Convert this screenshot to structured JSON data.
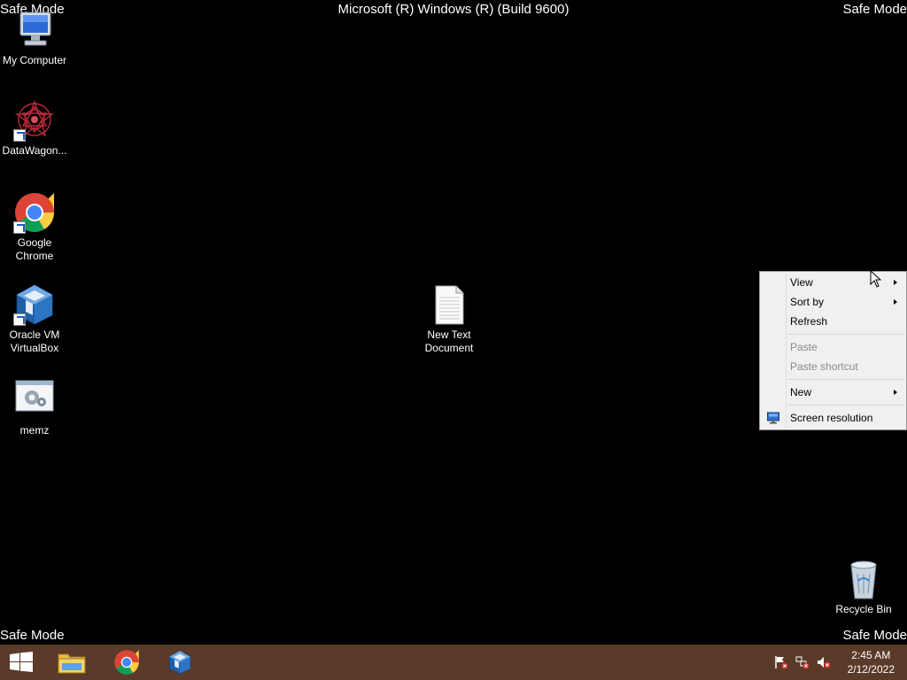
{
  "watermark": {
    "top_left": "Safe Mode",
    "top_right": "Safe Mode",
    "bottom_left": "Safe Mode",
    "bottom_right": "Safe Mode",
    "top_center": "Microsoft (R) Windows (R) (Build 9600)"
  },
  "desktop_icons": {
    "my_computer": "My Computer",
    "datawagon": "DataWagon...",
    "chrome_line1": "Google",
    "chrome_line2": "Chrome",
    "virtualbox_line1": "Oracle VM",
    "virtualbox_line2": "VirtualBox",
    "memz": "memz",
    "text_doc_line1": "New Text",
    "text_doc_line2": "Document",
    "recycle_bin": "Recycle Bin"
  },
  "context_menu": {
    "view": "View",
    "sort_by": "Sort by",
    "refresh": "Refresh",
    "paste": "Paste",
    "paste_shortcut": "Paste shortcut",
    "new": "New",
    "screen_resolution": "Screen resolution"
  },
  "taskbar": {
    "time": "2:45 AM",
    "date": "2/12/2022",
    "pinned": [
      "file-explorer",
      "google-chrome",
      "virtualbox"
    ]
  },
  "colors": {
    "desktop_bg": "#000000",
    "taskbar_bg": "#5a3a29",
    "menu_bg": "#f0f0f0",
    "disabled_text": "#8b8b8b"
  }
}
